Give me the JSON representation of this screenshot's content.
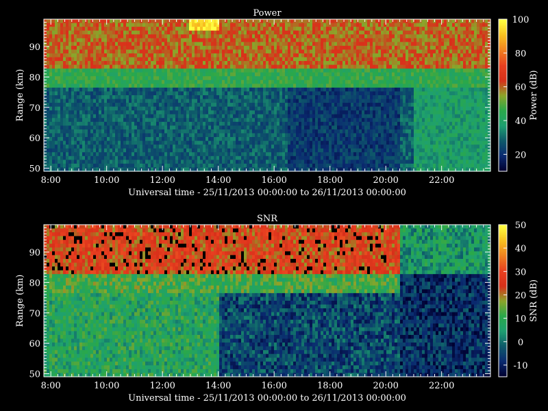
{
  "chart_data": [
    {
      "type": "heatmap",
      "title": "Power",
      "xlabel": "Universal time - 25/11/2013 00:00:00 to 26/11/2013 00:00:00",
      "ylabel": "Range (km)",
      "x_ticks": [
        "8:00",
        "10:00",
        "12:00",
        "14:00",
        "16:00",
        "18:00",
        "20:00",
        "22:00"
      ],
      "x_tick_hours": [
        8,
        10,
        12,
        14,
        16,
        18,
        20,
        22
      ],
      "xlim_hours": [
        7.75,
        23.75
      ],
      "y_ticks": [
        50,
        60,
        70,
        80,
        90
      ],
      "ylim": [
        49,
        99
      ],
      "colorbar_label": "Power (dB)",
      "colorbar_ticks": [
        20,
        40,
        60,
        80,
        100
      ],
      "colorbar_range": [
        10,
        100
      ],
      "layers": [
        {
          "range_km": [
            49,
            77
          ],
          "value_db": 28
        },
        {
          "range_km": [
            77,
            83
          ],
          "value_db": 45
        },
        {
          "range_km": [
            83,
            99
          ],
          "value_db": 60
        }
      ],
      "highlight": {
        "hours": [
          13.0,
          14.0
        ],
        "range_km": [
          95,
          99
        ],
        "value_db": 95
      }
    },
    {
      "type": "heatmap",
      "title": "SNR",
      "xlabel": "Universal time - 25/11/2013 00:00:00 to 26/11/2013 00:00:00",
      "ylabel": "Range (km)",
      "x_ticks": [
        "8:00",
        "10:00",
        "12:00",
        "14:00",
        "16:00",
        "18:00",
        "20:00",
        "22:00"
      ],
      "x_tick_hours": [
        8,
        10,
        12,
        14,
        16,
        18,
        20,
        22
      ],
      "xlim_hours": [
        7.75,
        23.75
      ],
      "y_ticks": [
        50,
        60,
        70,
        80,
        90
      ],
      "ylim": [
        49,
        99
      ],
      "colorbar_label": "SNR (dB)",
      "colorbar_ticks": [
        -10,
        0,
        10,
        20,
        30,
        40,
        50
      ],
      "colorbar_range": [
        -15,
        50
      ],
      "layers": [
        {
          "range_km": [
            49,
            77
          ],
          "value_db_before_14h": 8,
          "value_db_after_14h": -5
        },
        {
          "range_km": [
            77,
            83
          ],
          "value_db": 12
        },
        {
          "range_km": [
            83,
            99
          ],
          "value_db": 25
        }
      ]
    }
  ],
  "colors": {
    "background": "#000000",
    "axis": "#ffffff",
    "colormap": [
      "#000030",
      "#0a2a70",
      "#0e5a6a",
      "#1ea070",
      "#2aa84a",
      "#8ca52a",
      "#d8301a",
      "#e84020",
      "#f08020",
      "#f8c020",
      "#ffff40"
    ]
  }
}
